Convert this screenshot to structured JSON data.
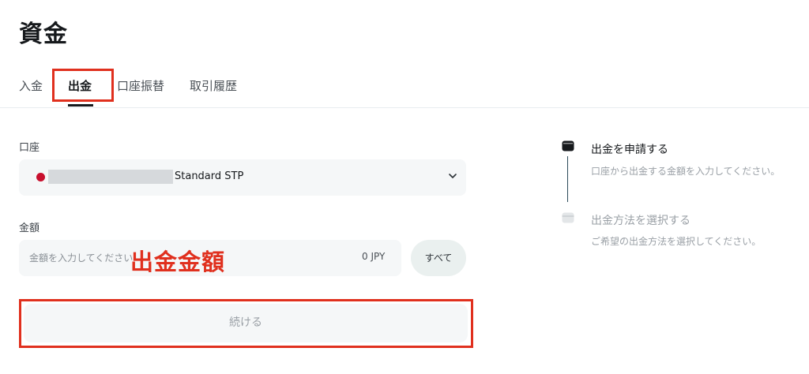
{
  "page": {
    "title": "資金"
  },
  "tabs": [
    {
      "label": "入金",
      "active": false
    },
    {
      "label": "出金",
      "active": true
    },
    {
      "label": "口座振替",
      "active": false
    },
    {
      "label": "取引履歴",
      "active": false
    }
  ],
  "form": {
    "account_label": "口座",
    "account_value": "Standard STP",
    "amount_label": "金額",
    "amount_placeholder": "金額を入力してください",
    "amount_value": "0 JPY",
    "all_button": "すべて",
    "continue_button": "続ける"
  },
  "annotations": {
    "amount_overlay": "出金金額"
  },
  "steps": [
    {
      "title": "出金を申請する",
      "description": "口座から出金する金額を入力してください。",
      "active": true
    },
    {
      "title": "出金方法を選択する",
      "description": "ご希望の出金方法を選択してください。",
      "active": false
    }
  ],
  "colors": {
    "highlight": "#e0301e",
    "account_dot": "#c8102e",
    "step_active": "#16191c",
    "step_inactive": "#9aa0a6"
  }
}
